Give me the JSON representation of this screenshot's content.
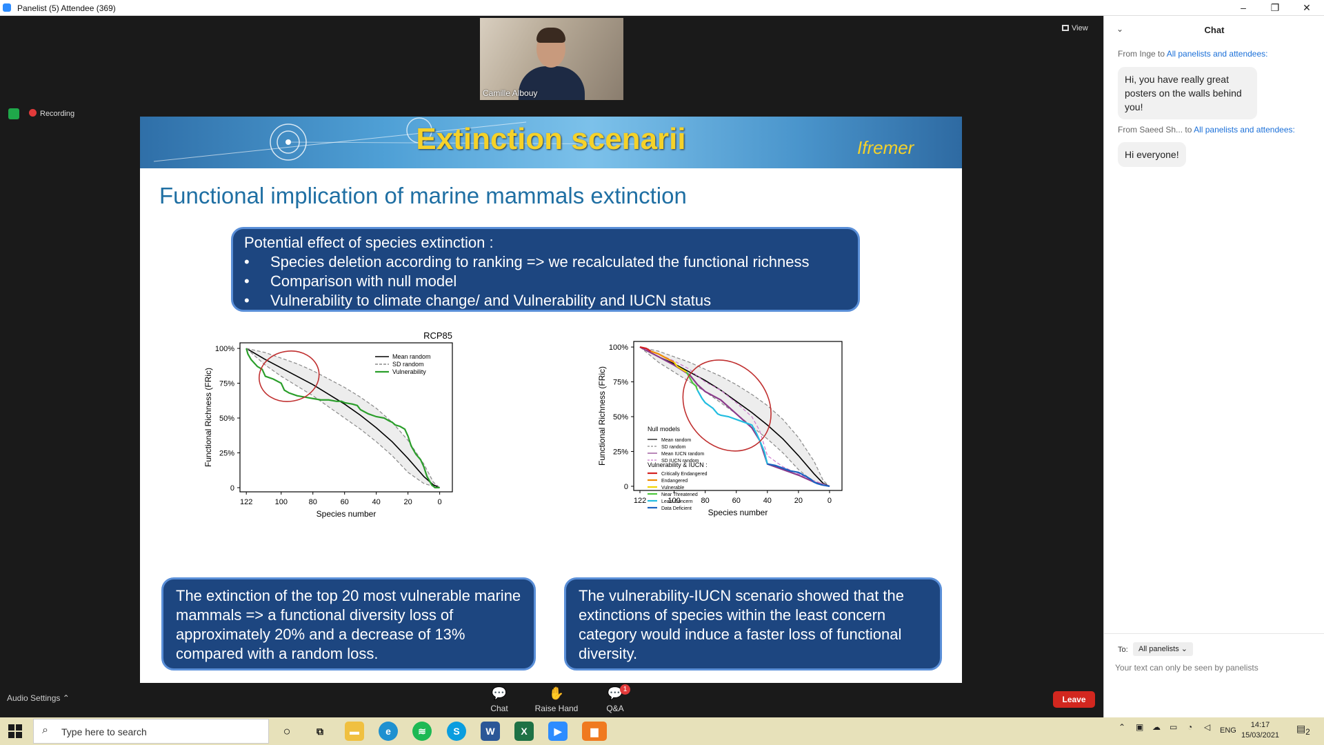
{
  "window": {
    "title": "Panelist (5) Attendee (369)"
  },
  "video": {
    "participant_name": "Camille Albouy",
    "view_label": "View",
    "recording_label": "Recording"
  },
  "slide": {
    "banner_title": "Extinction scenarii",
    "logo_text": "Ifremer",
    "heading": "Functional implication of marine mammals extinction",
    "intro": "Potential effect of species extinction :",
    "bullets": [
      "Species deletion according to ranking  => we recalculated the functional richness",
      "Comparison with null model",
      "Vulnerability to climate change/  and Vulnerability and IUCN status"
    ],
    "bullet_symbol": "•",
    "conclusion_left": "The extinction of the top 20 most vulnerable marine mammals =>  a functional diversity loss of approximately 20% and a decrease of 13% compared with a random loss.",
    "conclusion_right": "The vulnerability-IUCN scenario showed that the extinctions of species within the least concern category would induce a faster loss of functional diversity."
  },
  "chart_data": [
    {
      "type": "line",
      "title": "RCP85",
      "xlabel": "Species number",
      "ylabel": "Functional Richness (FRic)",
      "x_ticks": [
        "122",
        "100",
        "80",
        "60",
        "40",
        "20",
        "0"
      ],
      "y_ticks": [
        "0",
        "25%",
        "50%",
        "75%",
        "100%"
      ],
      "xlim": [
        126,
        -8
      ],
      "ylim": [
        -3,
        104
      ],
      "series": [
        {
          "name": "Mean random",
          "color": "#000000",
          "style": "solid",
          "x": [
            122,
            110,
            100,
            90,
            80,
            70,
            60,
            50,
            40,
            30,
            20,
            10,
            4,
            0
          ],
          "y": [
            100,
            92,
            86,
            80,
            74,
            67,
            60,
            52,
            43,
            33,
            21,
            8,
            2,
            0
          ]
        },
        {
          "name": "SD random",
          "color": "#888888",
          "style": "dashed",
          "x": [
            122,
            110,
            100,
            90,
            80,
            70,
            60,
            50,
            40,
            30,
            20,
            10,
            4,
            0
          ],
          "y": [
            100,
            97,
            93,
            89,
            84,
            78,
            72,
            65,
            57,
            47,
            34,
            17,
            4,
            0
          ]
        },
        {
          "name": "SD random lower",
          "color": "#888888",
          "style": "dashed",
          "x": [
            122,
            110,
            100,
            90,
            80,
            70,
            60,
            50,
            40,
            30,
            20,
            10,
            4,
            0
          ],
          "y": [
            100,
            88,
            80,
            73,
            66,
            58,
            50,
            42,
            33,
            23,
            11,
            3,
            1,
            0
          ]
        },
        {
          "name": "Vulnerability",
          "color": "#2a9e2a",
          "style": "solid",
          "x": [
            122,
            121,
            119,
            115,
            112,
            110,
            105,
            100,
            98,
            95,
            90,
            85,
            80,
            75,
            70,
            65,
            62,
            60,
            55,
            52,
            50,
            45,
            40,
            35,
            32,
            30,
            28,
            25,
            22,
            20,
            18,
            15,
            12,
            10,
            8,
            5,
            3,
            0
          ],
          "y": [
            100,
            96,
            92,
            87,
            85,
            80,
            78,
            75,
            70,
            68,
            66,
            65,
            64,
            63,
            63,
            62,
            62,
            61,
            60,
            59,
            56,
            53,
            51,
            50,
            48,
            47,
            45,
            44,
            42,
            37,
            30,
            24,
            20,
            15,
            8,
            2,
            0,
            0
          ]
        }
      ],
      "annotation": {
        "shape": "ellipse",
        "color": "#c03030",
        "center": [
          95,
          80
        ],
        "radius": [
          19,
          18
        ]
      }
    },
    {
      "type": "line",
      "xlabel": "Species number",
      "ylabel": "Functional Richness (FRic)",
      "x_ticks": [
        "122",
        "100",
        "80",
        "60",
        "40",
        "20",
        "0"
      ],
      "y_ticks": [
        "0",
        "25%",
        "50%",
        "75%",
        "100%"
      ],
      "xlim": [
        126,
        -8
      ],
      "ylim": [
        -3,
        104
      ],
      "legend_title_1": "Null models",
      "legend_title_2": "Vulnerability & IUCN :",
      "legend": [
        {
          "name": "Mean random",
          "color": "#000000"
        },
        {
          "name": "SD random",
          "color": "#888888"
        },
        {
          "name": "Mean IUCN random",
          "color": "#8a3a8a"
        },
        {
          "name": "SD IUCN random",
          "color": "#cc77cc"
        },
        {
          "name": "Critically Endangered",
          "color": "#d42020"
        },
        {
          "name": "Endangered",
          "color": "#f08a00"
        },
        {
          "name": "Vulnerable",
          "color": "#f2d400"
        },
        {
          "name": "Near Threatened",
          "color": "#4cc83c"
        },
        {
          "name": "Least Concern",
          "color": "#22bde0"
        },
        {
          "name": "Data Deficient",
          "color": "#1a62c0"
        }
      ],
      "series": [
        {
          "name": "Mean random",
          "color": "#000000",
          "style": "solid",
          "x": [
            122,
            110,
            100,
            90,
            80,
            70,
            60,
            50,
            40,
            30,
            20,
            10,
            4,
            0
          ],
          "y": [
            100,
            93,
            88,
            82,
            76,
            69,
            61,
            53,
            44,
            34,
            22,
            9,
            2,
            0
          ]
        },
        {
          "name": "SD random",
          "color": "#888888",
          "style": "dashed",
          "x": [
            122,
            110,
            100,
            90,
            80,
            70,
            60,
            50,
            40,
            30,
            20,
            10,
            4,
            0
          ],
          "y": [
            100,
            97,
            93,
            89,
            84,
            79,
            73,
            66,
            58,
            48,
            35,
            18,
            4,
            0
          ]
        },
        {
          "name": "SD random lower",
          "color": "#888888",
          "style": "dashed",
          "x": [
            122,
            110,
            100,
            90,
            80,
            70,
            60,
            50,
            40,
            30,
            20,
            10,
            4,
            0
          ],
          "y": [
            100,
            89,
            82,
            75,
            68,
            60,
            52,
            43,
            34,
            24,
            12,
            3,
            1,
            0
          ]
        },
        {
          "name": "Mean IUCN random",
          "color": "#8a3a8a",
          "style": "solid",
          "x": [
            122,
            110,
            100,
            90,
            85,
            80,
            70,
            60,
            50,
            45,
            40,
            30,
            20,
            10,
            0
          ],
          "y": [
            100,
            93,
            87,
            80,
            73,
            68,
            62,
            52,
            42,
            33,
            16,
            12,
            8,
            3,
            0
          ]
        },
        {
          "name": "SD IUCN random",
          "color": "#cc77cc",
          "style": "dashed",
          "x": [
            122,
            110,
            100,
            90,
            85,
            80,
            70,
            60,
            50,
            45,
            40,
            30,
            20,
            10,
            0
          ],
          "y": [
            100,
            95,
            90,
            84,
            79,
            75,
            69,
            60,
            50,
            40,
            22,
            14,
            9,
            4,
            0
          ]
        },
        {
          "name": "Critically Endangered",
          "color": "#d42020",
          "style": "solid",
          "x": [
            122,
            118,
            115
          ],
          "y": [
            100,
            99,
            97
          ]
        },
        {
          "name": "Endangered",
          "color": "#f08a00",
          "style": "solid",
          "x": [
            115,
            110,
            105,
            100
          ],
          "y": [
            97,
            95,
            92,
            89
          ]
        },
        {
          "name": "Vulnerable",
          "color": "#f2d400",
          "style": "solid",
          "x": [
            100,
            98,
            95,
            92
          ],
          "y": [
            89,
            86,
            84,
            82
          ]
        },
        {
          "name": "Near Threatened",
          "color": "#4cc83c",
          "style": "solid",
          "x": [
            92,
            90,
            88,
            86,
            85
          ],
          "y": [
            82,
            78,
            74,
            72,
            69
          ]
        },
        {
          "name": "Least Concern",
          "color": "#22bde0",
          "style": "solid",
          "x": [
            85,
            82,
            80,
            75,
            72,
            70,
            65,
            60,
            55,
            50,
            47,
            45,
            42,
            40
          ],
          "y": [
            69,
            63,
            60,
            56,
            52,
            51,
            50,
            48,
            46,
            44,
            38,
            33,
            25,
            16
          ]
        },
        {
          "name": "Data Deficient",
          "color": "#1a62c0",
          "style": "solid",
          "x": [
            40,
            35,
            30,
            25,
            20,
            15,
            12,
            10,
            8,
            5,
            0
          ],
          "y": [
            16,
            15,
            13,
            11,
            10,
            7,
            5,
            3,
            2,
            1,
            0
          ]
        }
      ],
      "annotation": {
        "shape": "ellipse",
        "color": "#c03030",
        "center": [
          66,
          58
        ],
        "radius": [
          26,
          35
        ]
      }
    }
  ],
  "chat": {
    "header": "Chat",
    "messages": [
      {
        "from_name": "From Inge to",
        "to_name": "All panelists and attendees:",
        "text": "Hi, you have really great posters on the walls behind you!"
      },
      {
        "from_name": "From Saeed Sh...  to",
        "to_name": "All panelists and attendees:",
        "text": "Hi everyone!"
      }
    ],
    "to_label": "To:",
    "to_value": "All panelists",
    "input_placeholder": "Your text can only be seen by panelists"
  },
  "toolbar": {
    "audio_settings": "Audio Settings",
    "chat": "Chat",
    "raise_hand": "Raise Hand",
    "qa": "Q&A",
    "qa_badge": "1",
    "leave": "Leave"
  },
  "taskbar": {
    "search_placeholder": "Type here to search",
    "language": "ENG",
    "time": "14:17",
    "date": "15/03/2021",
    "notification_count": "2"
  },
  "colors": {
    "slide_box": "#1d4680",
    "slide_heading": "#1f6fa3",
    "banner_title": "#f5d22a",
    "leave": "#d2271f",
    "link": "#1a6fd8"
  }
}
